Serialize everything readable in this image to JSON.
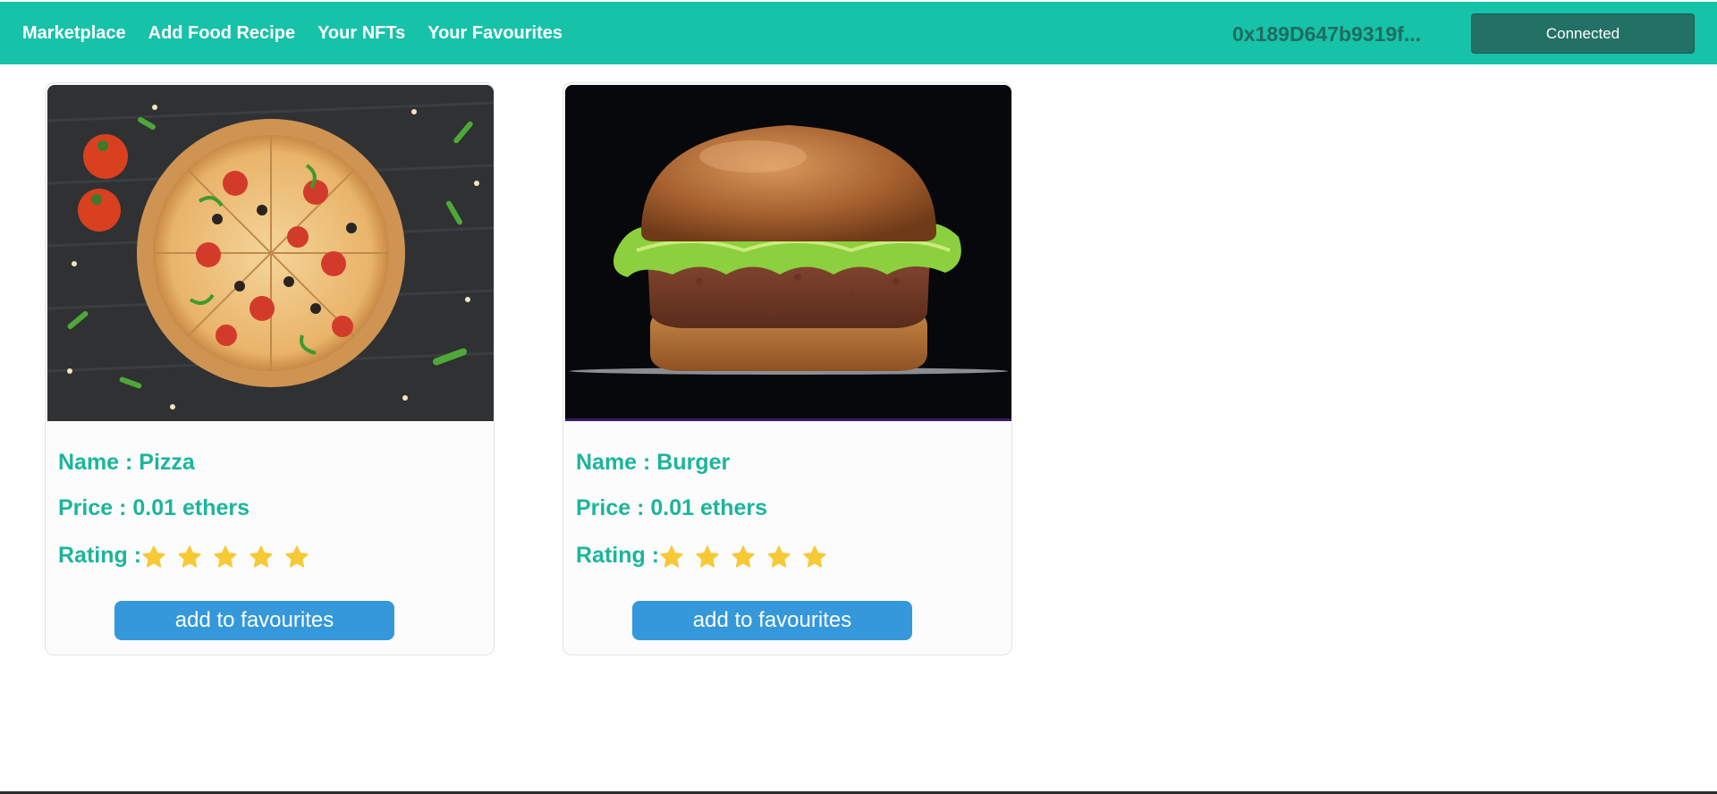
{
  "nav": {
    "links": [
      "Marketplace",
      "Add Food Recipe",
      "Your NFTs",
      "Your Favourites"
    ],
    "wallet_address": "0x189D647b9319f...",
    "connect_label": "Connected"
  },
  "colors": {
    "navbar": "#16c2a8",
    "accent_text": "#1cb59b",
    "button": "#3498db",
    "star": "#f7c935"
  },
  "cards": [
    {
      "name": "Name : Pizza",
      "price": "Price : 0.01 ethers",
      "rating_label": "Rating :",
      "rating": 5,
      "button": "add to favourites",
      "image": "pizza"
    },
    {
      "name": "Name : Burger",
      "price": "Price : 0.01 ethers",
      "rating_label": "Rating :",
      "rating": 5,
      "button": "add to favourites",
      "image": "burger"
    }
  ]
}
